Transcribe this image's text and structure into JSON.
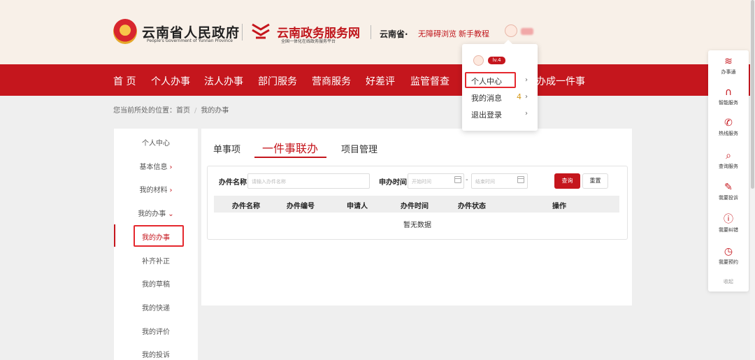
{
  "header": {
    "gov_title": "云南省人民政府",
    "gov_subtitle": "People's Government of Yunnan Province",
    "service_title": "云南政务服务网",
    "service_subtitle": "全国一体化在线政务服务平台",
    "province": "云南省",
    "province_caret": "·",
    "barrier_free": "无障碍浏览",
    "newbie_guide": "新手教程"
  },
  "nav": {
    "items": [
      "首 页",
      "个人办事",
      "法人办事",
      "部门服务",
      "营商服务",
      "好差评",
      "监管督查",
      "高效办成一件事"
    ]
  },
  "breadcrumb": {
    "prefix": "您当前所处的位置：首页",
    "separator": "/",
    "current": "我的办事"
  },
  "sidebar": {
    "items": [
      {
        "label": "个人中心"
      },
      {
        "label": "基本信息",
        "arrow": "›"
      },
      {
        "label": "我的材料",
        "arrow": "›"
      },
      {
        "label": "我的办事",
        "arrow": "⌄"
      },
      {
        "label": "我的办事"
      },
      {
        "label": "补齐补正"
      },
      {
        "label": "我的草稿"
      },
      {
        "label": "我的快递"
      },
      {
        "label": "我的评价"
      },
      {
        "label": "我的投诉"
      }
    ]
  },
  "tabs": [
    "单事项",
    "一件事联办",
    "项目管理"
  ],
  "search": {
    "name_label": "办件名称",
    "name_placeholder": "请输入办件名称",
    "time_label": "申办时间",
    "start_placeholder": "开始时间",
    "date_dash": "-",
    "end_placeholder": "结束时间",
    "query_button": "查询",
    "reset_button": "重置"
  },
  "table": {
    "columns": [
      "办件名称",
      "办件编号",
      "申请人",
      "办件时间",
      "办件状态",
      "操作"
    ],
    "empty_text": "暂无数据"
  },
  "dropdown": {
    "level": "lv.4",
    "items": [
      {
        "label": "个人中心",
        "chevron": "›"
      },
      {
        "label": "我的消息",
        "count": "4",
        "chevron": "›"
      },
      {
        "label": "退出登录",
        "chevron": "›"
      }
    ]
  },
  "right_panel": {
    "items": [
      {
        "label": "办事通",
        "icon": "logo-icon",
        "glyph": "≋"
      },
      {
        "label": "智能服务",
        "icon": "headset-icon",
        "glyph": "∩"
      },
      {
        "label": "热线服务",
        "icon": "phone-icon",
        "glyph": "✆"
      },
      {
        "label": "查询服务",
        "icon": "search-icon",
        "glyph": "⌕"
      },
      {
        "label": "我要投诉",
        "icon": "pen-icon",
        "glyph": "✎"
      },
      {
        "label": "我要纠错",
        "icon": "alert-icon",
        "glyph": "ⓘ"
      },
      {
        "label": "我要预约",
        "icon": "clock-icon",
        "glyph": "◷"
      }
    ],
    "collapse": "收起"
  },
  "colors": {
    "accent": "#c5161d",
    "header_bg": "#f8f0e8",
    "page_bg": "#efefef"
  }
}
